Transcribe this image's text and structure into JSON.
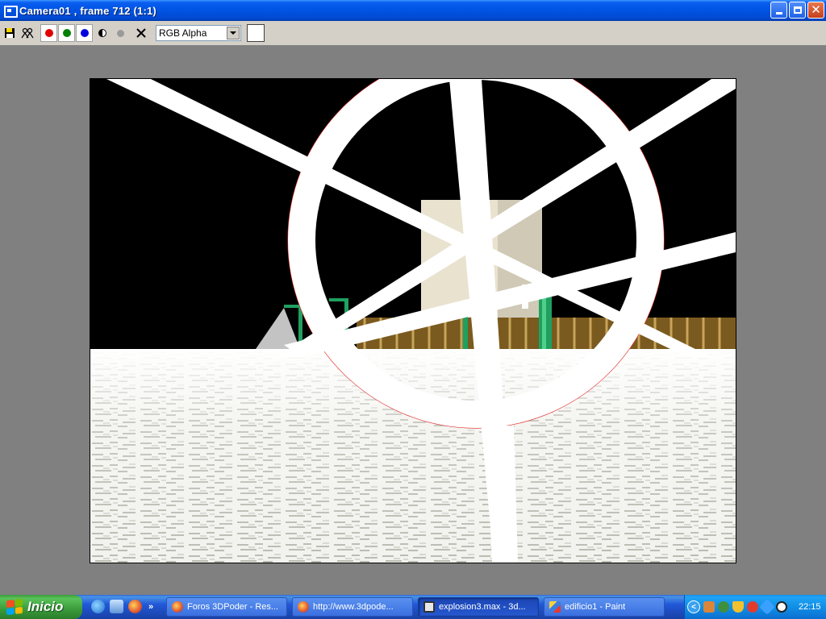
{
  "window": {
    "title": "Camera01 , frame 712 (1:1)",
    "buttons": {
      "minimize": "minimize",
      "restore": "restore",
      "close": "✕"
    }
  },
  "toolbar": {
    "channel_select_value": "RGB Alpha",
    "channel_colors": {
      "red": "#e00000",
      "green": "#008000",
      "blue": "#0000e0"
    },
    "icons": [
      "save-icon",
      "clone-icon",
      "red-channel-icon",
      "green-channel-icon",
      "blue-channel-icon",
      "monochrome-icon",
      "alpha-dot-icon",
      "clear-icon"
    ]
  },
  "render": {
    "background": "#000000",
    "ring_color": "#ffffff",
    "ring_edge_color": "#e02020",
    "pole_color": "#1fa060",
    "wall_color": "#a07828"
  },
  "taskbar": {
    "start_label": "Inicio",
    "quick_more": "»",
    "tasks": [
      {
        "label": "Foros 3DPoder - Res...",
        "icon": "firefox-icon",
        "active": false
      },
      {
        "label": "http://www.3dpode...",
        "icon": "firefox-icon",
        "active": false
      },
      {
        "label": "explosion3.max - 3d...",
        "icon": "max-icon",
        "active": true
      },
      {
        "label": "edificio1 - Paint",
        "icon": "paint-icon",
        "active": false
      }
    ],
    "clock": "22:15"
  }
}
